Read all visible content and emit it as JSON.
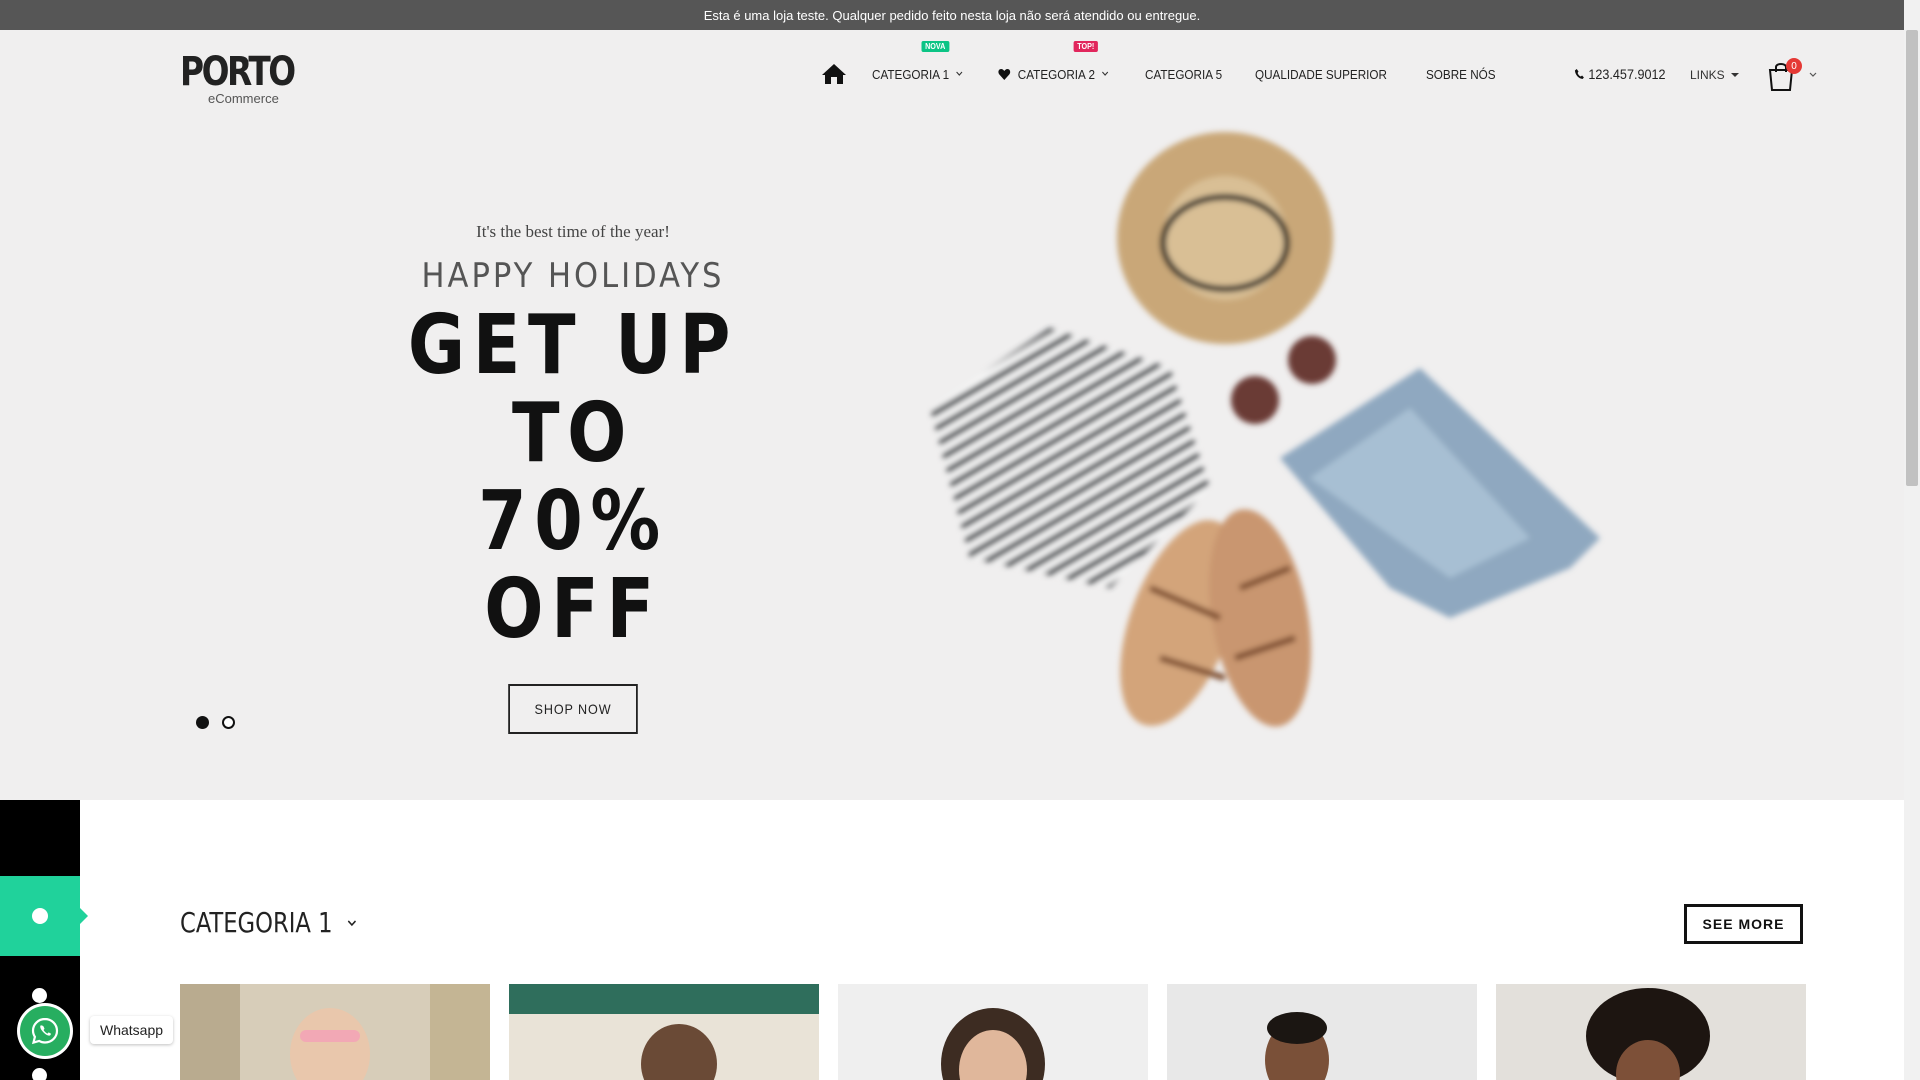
{
  "notice_bar": {
    "text": "Esta é uma loja teste. Qualquer pedido feito nesta loja não será atendido ou entregue."
  },
  "header": {
    "logo_main": "PORTO",
    "logo_sub": "eCommerce",
    "nav": [
      {
        "label": "CATEGORIA 1",
        "badge": "NOVA",
        "has_dropdown": true
      },
      {
        "label": "CATEGORIA 2",
        "badge": "TOP!",
        "has_dropdown": true,
        "icon": "heart-icon"
      },
      {
        "label": "CATEGORIA 5"
      },
      {
        "label": "QUALIDADE SUPERIOR"
      },
      {
        "label": "SOBRE NÓS"
      }
    ],
    "phone": "123.457.9012",
    "links_label": "LINKS",
    "cart_count": "0"
  },
  "hero": {
    "kicker": "It's the best time of the year!",
    "subtitle": "HAPPY HOLIDAYS",
    "title_line1": "GET UP TO",
    "title_line2": "70% OFF",
    "button": "SHOP NOW",
    "slides": 2,
    "active_slide": 1
  },
  "whatsapp": {
    "label": "Whatsapp"
  },
  "category_section": {
    "title": "CATEGORIA 1",
    "see_more": "SEE MORE"
  },
  "products": [
    {
      "name": "product-1"
    },
    {
      "name": "product-2"
    },
    {
      "name": "product-3"
    },
    {
      "name": "product-4"
    },
    {
      "name": "product-5"
    }
  ],
  "colors": {
    "notice_bg": "#565656",
    "hero_bg": "#f0efef",
    "badge_green": "#0cc485",
    "badge_pink": "#e1265c",
    "whatsapp_green": "#27ae60",
    "side_accent": "#20d29b"
  }
}
